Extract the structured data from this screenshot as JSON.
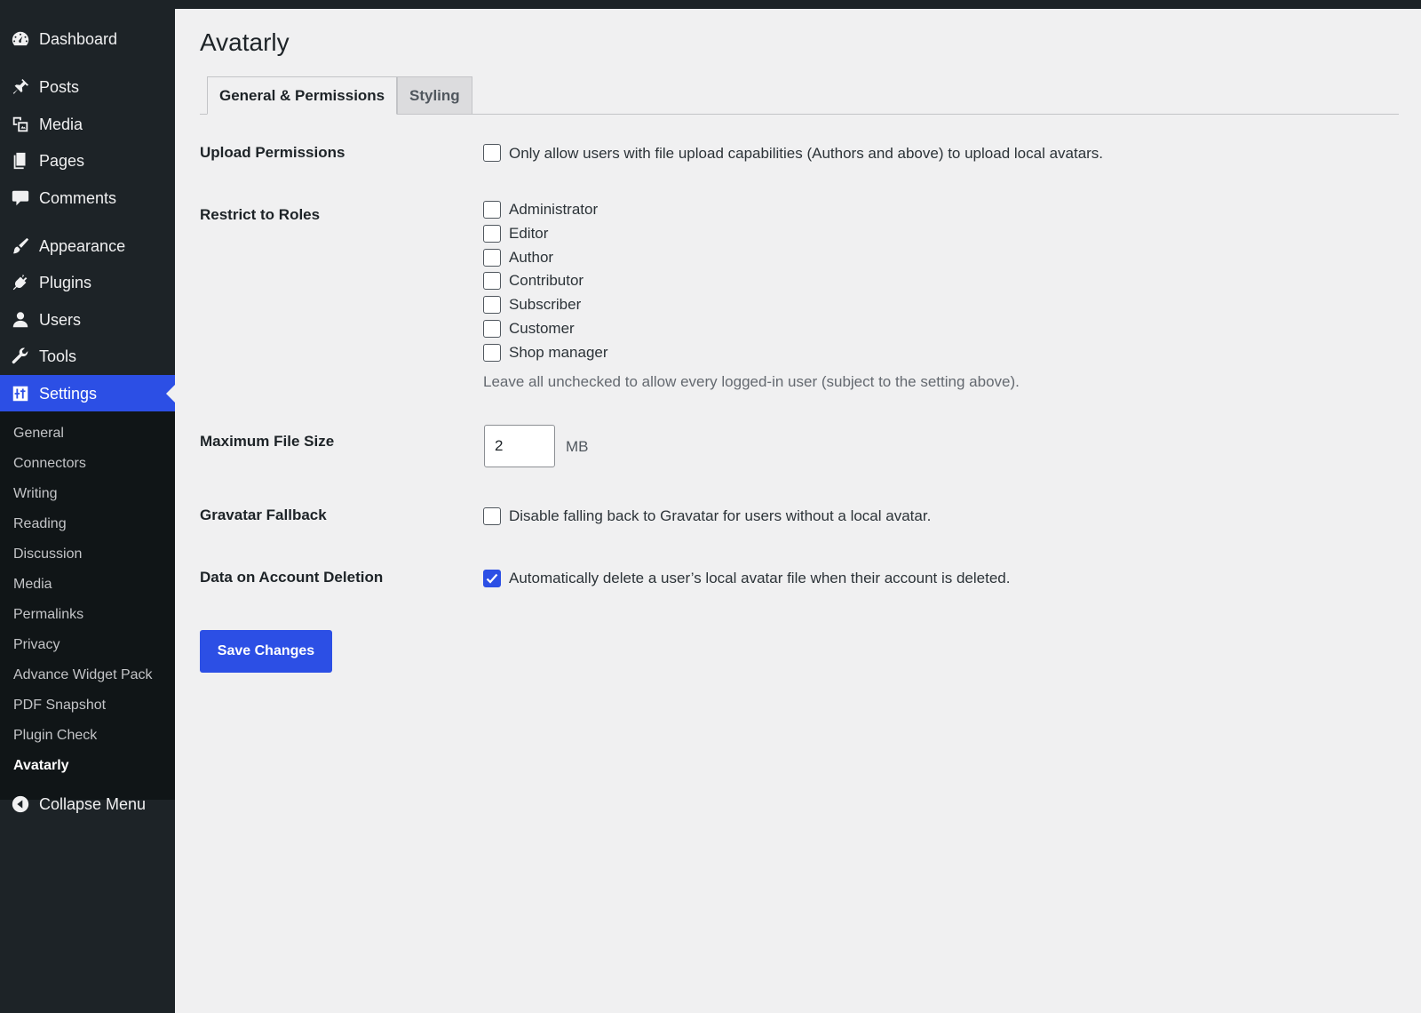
{
  "sidebar": {
    "items": [
      {
        "label": "Dashboard",
        "icon": "dashboard-icon"
      },
      {
        "label": "Posts",
        "icon": "pin-icon"
      },
      {
        "label": "Media",
        "icon": "media-icon"
      },
      {
        "label": "Pages",
        "icon": "pages-icon"
      },
      {
        "label": "Comments",
        "icon": "comment-icon"
      },
      {
        "label": "Appearance",
        "icon": "brush-icon"
      },
      {
        "label": "Plugins",
        "icon": "plug-icon"
      },
      {
        "label": "Users",
        "icon": "user-icon"
      },
      {
        "label": "Tools",
        "icon": "wrench-icon"
      },
      {
        "label": "Settings",
        "icon": "settings-icon"
      }
    ],
    "submenu": [
      "General",
      "Connectors",
      "Writing",
      "Reading",
      "Discussion",
      "Media",
      "Permalinks",
      "Privacy",
      "Advance Widget Pack",
      "PDF Snapshot",
      "Plugin Check",
      "Avatarly"
    ],
    "collapse_label": "Collapse Menu"
  },
  "page": {
    "title": "Avatarly",
    "tabs": [
      "General & Permissions",
      "Styling"
    ]
  },
  "form": {
    "upload": {
      "label": "Upload Permissions",
      "option": "Only allow users with file upload capabilities (Authors and above) to upload local avatars.",
      "checked": false
    },
    "roles": {
      "label": "Restrict to Roles",
      "options": [
        "Administrator",
        "Editor",
        "Author",
        "Contributor",
        "Subscriber",
        "Customer",
        "Shop manager"
      ],
      "description": "Leave all unchecked to allow every logged-in user (subject to the setting above)."
    },
    "filesize": {
      "label": "Maximum File Size",
      "value": "2",
      "unit": "MB"
    },
    "gravatar": {
      "label": "Gravatar Fallback",
      "option": "Disable falling back to Gravatar for users without a local avatar.",
      "checked": false
    },
    "deletion": {
      "label": "Data on Account Deletion",
      "option": "Automatically delete a user’s local avatar file when their account is deleted.",
      "checked": true
    },
    "save_label": "Save Changes"
  },
  "colors": {
    "sidebar_bg": "#1d2327",
    "accent": "#2c4fe5",
    "page_bg": "#f0f0f1"
  }
}
